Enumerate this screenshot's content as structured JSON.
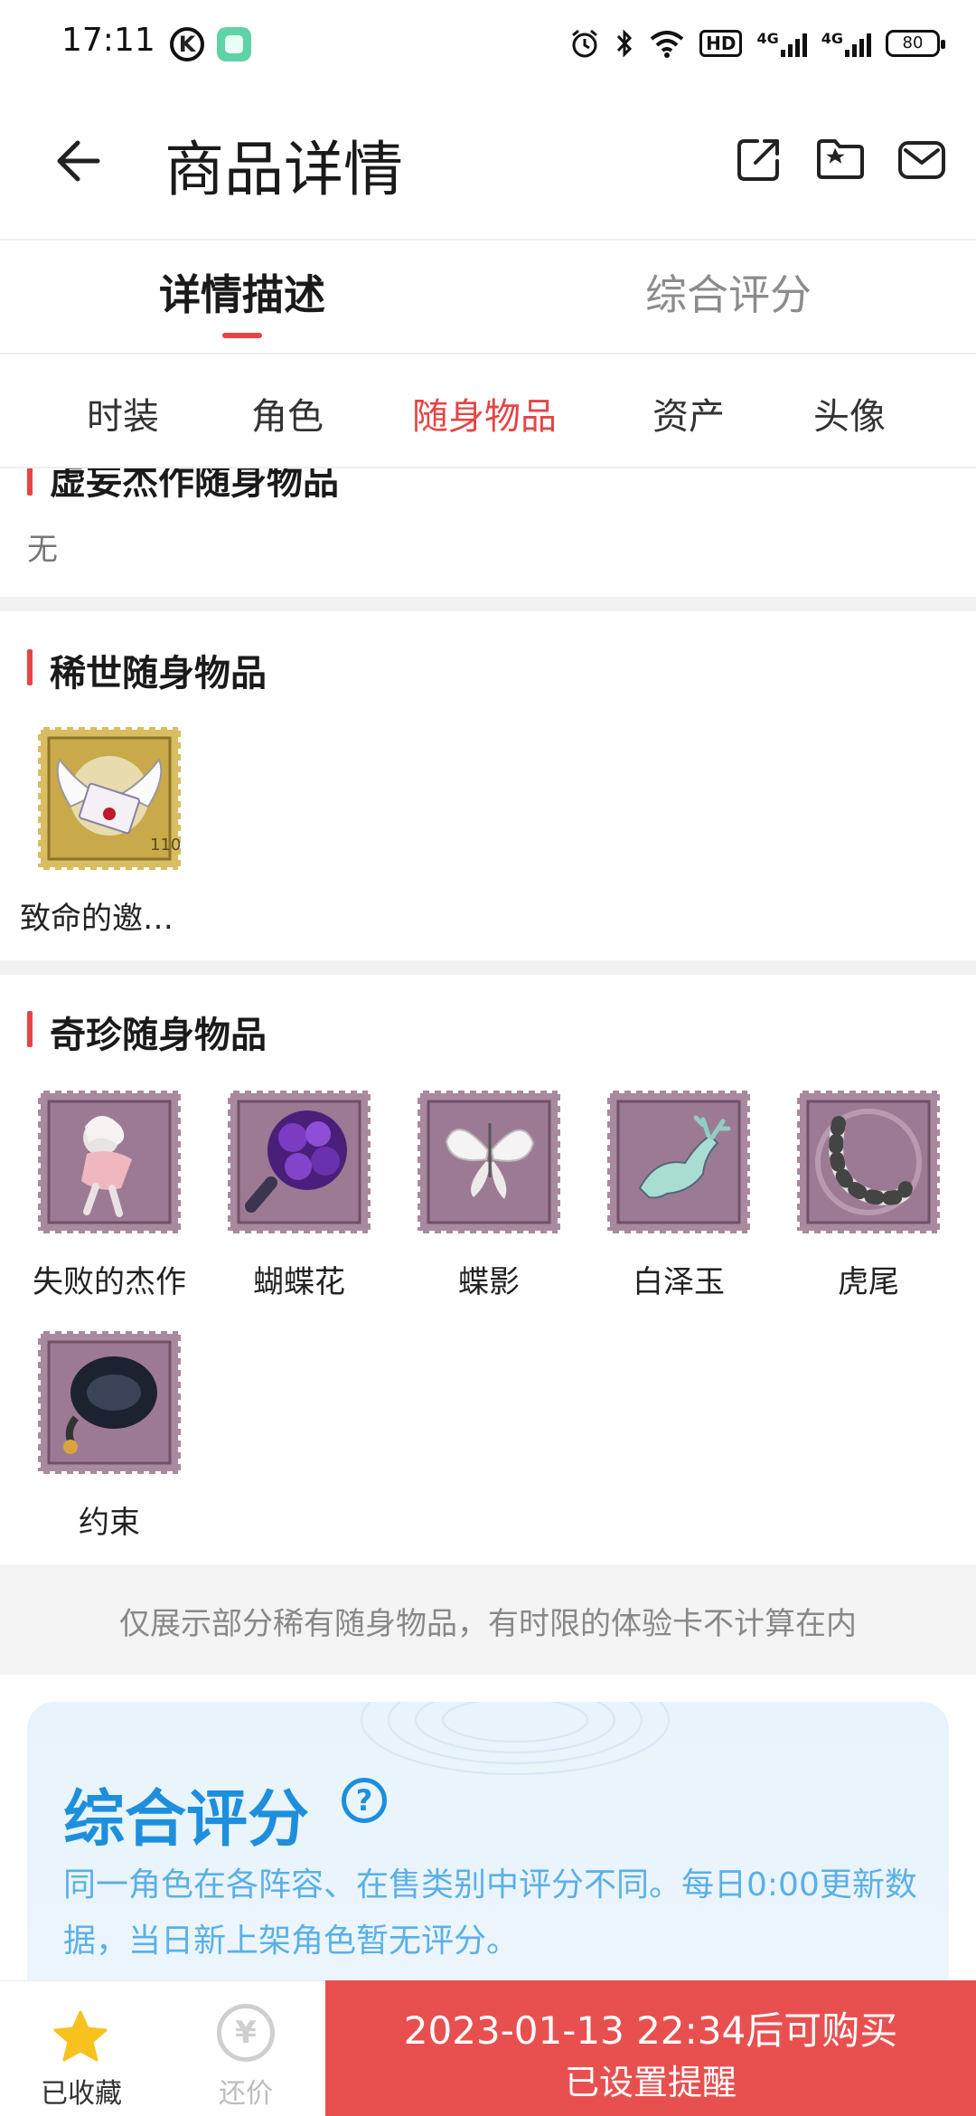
{
  "status_bar": {
    "time": "17:11",
    "k_badge": "K",
    "hd_label": "HD",
    "net1": "4G",
    "net2": "4G",
    "battery": "80",
    "icons": [
      "alarm-icon",
      "bluetooth-icon",
      "wifi-icon",
      "signal-icon"
    ]
  },
  "header": {
    "title": "商品详情",
    "icons": [
      "back-arrow-icon",
      "share-icon",
      "folder-star-icon",
      "mail-icon"
    ]
  },
  "tabs": [
    {
      "label": "详情描述",
      "active": true
    },
    {
      "label": "综合评分",
      "active": false
    }
  ],
  "subtabs": [
    {
      "label": "时装",
      "active": false
    },
    {
      "label": "角色",
      "active": false
    },
    {
      "label": "随身物品",
      "active": true
    },
    {
      "label": "资产",
      "active": false
    },
    {
      "label": "头像",
      "active": false
    }
  ],
  "sections": {
    "partial": {
      "title": "虚妄杰作随身物品",
      "empty_text": "无"
    },
    "rare": {
      "title": "稀世随身物品",
      "items": [
        {
          "label": "致命的邀…",
          "icon": "winged-letter-stamp"
        }
      ]
    },
    "treasure": {
      "title": "奇珍随身物品",
      "items": [
        {
          "label": "失败的杰作",
          "icon": "doll-stamp"
        },
        {
          "label": "蝴蝶花",
          "icon": "purple-flower-stamp"
        },
        {
          "label": "蝶影",
          "icon": "butterfly-stamp"
        },
        {
          "label": "白泽玉",
          "icon": "jade-deer-stamp"
        },
        {
          "label": "虎尾",
          "icon": "tiger-tail-stamp"
        },
        {
          "label": "约束",
          "icon": "chain-restraint-stamp"
        }
      ]
    }
  },
  "note": "仅展示部分稀有随身物品，有时限的体验卡不计算在内",
  "score_card": {
    "title": "综合评分",
    "help": "?",
    "description": "同一角色在各阵容、在售类别中评分不同。每日0:00更新数据，当日新上架角色暂无评分。"
  },
  "bottom_bar": {
    "favorite_label": "已收藏",
    "bargain_label": "还价",
    "bargain_symbol": "¥",
    "buy_line1": "2023-01-13 22:34后可购买",
    "buy_line2": "已设置提醒"
  },
  "colors": {
    "accent_red": "#e54545",
    "buy_red": "#e85050",
    "score_blue": "#1d8fdc",
    "score_desc_blue": "#5ab0e6",
    "star_yellow": "#f7c21e",
    "stamp_gold": "#c9a94a",
    "stamp_purple": "#9d7a93"
  }
}
